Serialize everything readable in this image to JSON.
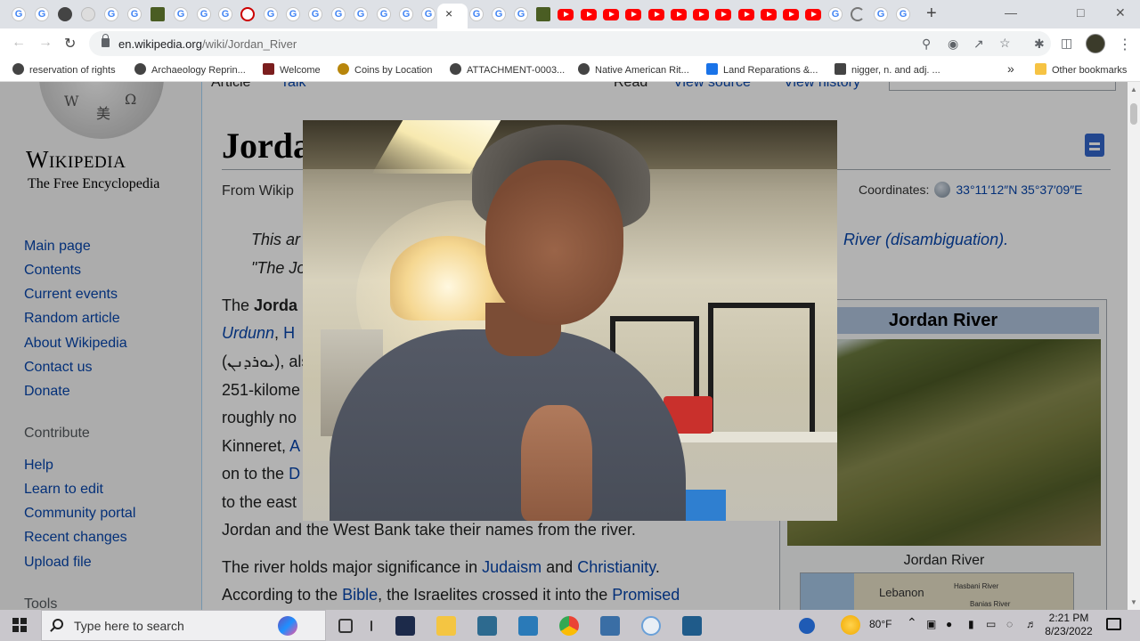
{
  "browser": {
    "url_domain": "en.wikipedia.org",
    "url_path": "/wiki/Jordan_River",
    "close_tab_glyph": "×",
    "new_tab_glyph": "+",
    "bookmarks": [
      {
        "label": "reservation of rights",
        "icon": "globe-icon"
      },
      {
        "label": "Archaeology Reprin...",
        "icon": "globe-icon"
      },
      {
        "label": "Welcome",
        "icon": "site-icon"
      },
      {
        "label": "Coins by Location",
        "icon": "site-icon"
      },
      {
        "label": "ATTACHMENT-0003...",
        "icon": "globe-icon"
      },
      {
        "label": "Native American Rit...",
        "icon": "globe-icon"
      },
      {
        "label": "Land Reparations &...",
        "icon": "site-icon"
      },
      {
        "label": "nigger, n. and adj. ...",
        "icon": "site-icon"
      }
    ],
    "bookmarks_overflow": "»",
    "other_bookmarks": "Other bookmarks"
  },
  "wiki": {
    "wordmark": "Wikipedia",
    "tagline": "The Free Encyclopedia",
    "nav": [
      "Main page",
      "Contents",
      "Current events",
      "Random article",
      "About Wikipedia",
      "Contact us",
      "Donate"
    ],
    "contribute_heading": "Contribute",
    "contribute": [
      "Help",
      "Learn to edit",
      "Community portal",
      "Recent changes",
      "Upload file"
    ],
    "tools_heading": "Tools",
    "tabs": {
      "article": "Article",
      "talk": "Talk",
      "read": "Read",
      "view_source": "View source",
      "view_history": "View history"
    },
    "title": "Jorda",
    "from": "From Wikip",
    "coordinates_label": "Coordinates:",
    "coordinates_value": "33°11′12″N 35°37′09″E",
    "hatnote_1": "This ar",
    "hatnote_2": "\"The Jo",
    "hatnote_link": "River (disambiguation).",
    "body": {
      "l1_pre": "The ",
      "l1_bold": "Jorda",
      "l2_a": "Urdunn",
      "l2_sep": ", ",
      "l2_b": "H",
      "l3_hebrew": "(ܝܘܪܕܢܢ)",
      "l3_rest": ", als",
      "l4": "251-kilome",
      "l5": "roughly no",
      "l6_a": "Kinneret, ",
      "l6_b": "A",
      "l7_a": "on to the ",
      "l7_b": "D",
      "l8": "to the east",
      "l9": "Jordan and the West Bank take their names from the river.",
      "p2_a": "The river holds major significance in ",
      "p2_judaism": "Judaism",
      "p2_and": " and ",
      "p2_christianity": "Christianity",
      "p2_end": ".",
      "p3_a": "According to the ",
      "p3_bible": "Bible",
      "p3_b": ", the Israelites crossed it into the ",
      "p3_promised": "Promised"
    },
    "infobox": {
      "title": "Jordan River",
      "caption": "Jordan River",
      "map_labels": {
        "lebanon": "Lebanon",
        "hasbani": "Hasbani River",
        "banias": "Banias River"
      }
    }
  },
  "taskbar": {
    "search_placeholder": "Type here to search",
    "weather": "80°F",
    "time": "2:21 PM",
    "date": "8/23/2022"
  },
  "colors": {
    "link": "#0645ad",
    "infobox_header": "#b0c4de",
    "chrome_tabstrip": "#dee1e6",
    "taskbar": "#c9c7cc"
  }
}
